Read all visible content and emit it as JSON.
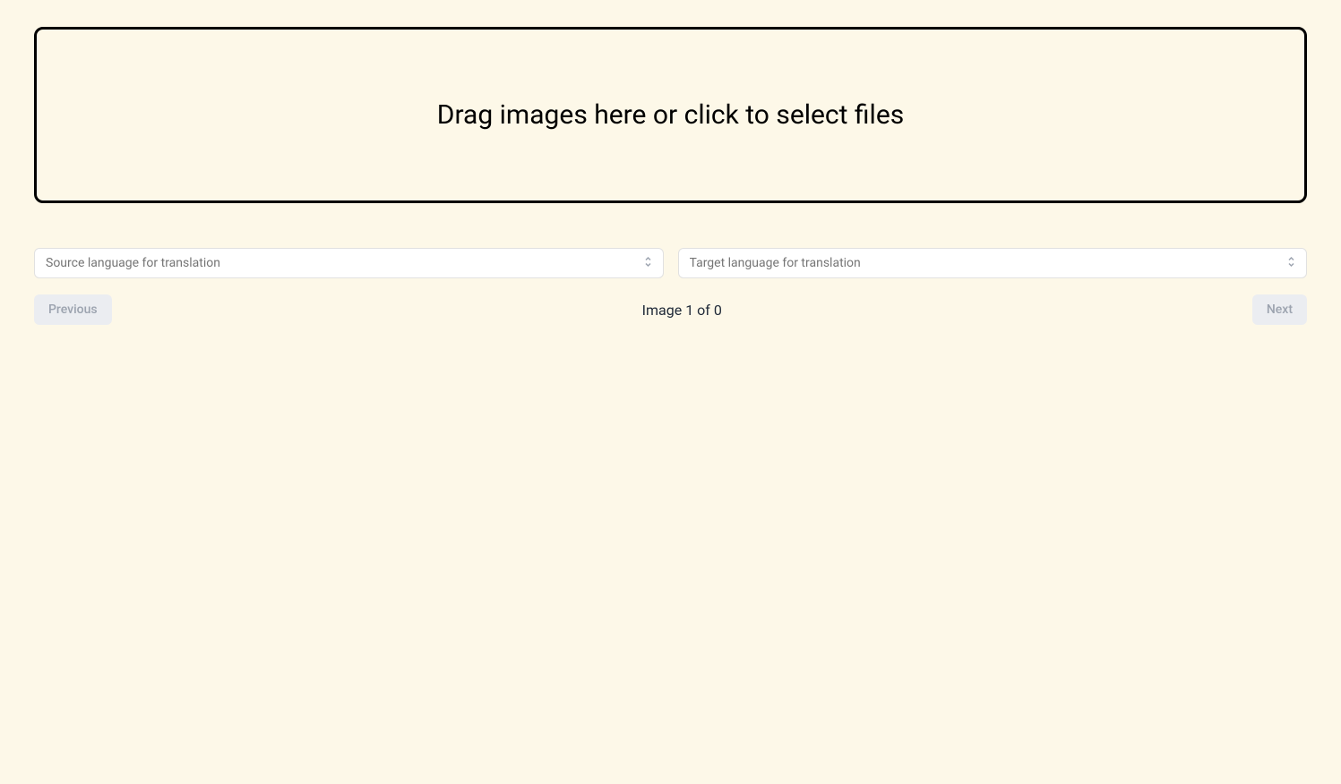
{
  "dropzone": {
    "text": "Drag images here or click to select files"
  },
  "languages": {
    "source_placeholder": "Source language for translation",
    "target_placeholder": "Target language for translation"
  },
  "navigation": {
    "previous_label": "Previous",
    "next_label": "Next",
    "counter_text": "Image 1 of 0"
  }
}
